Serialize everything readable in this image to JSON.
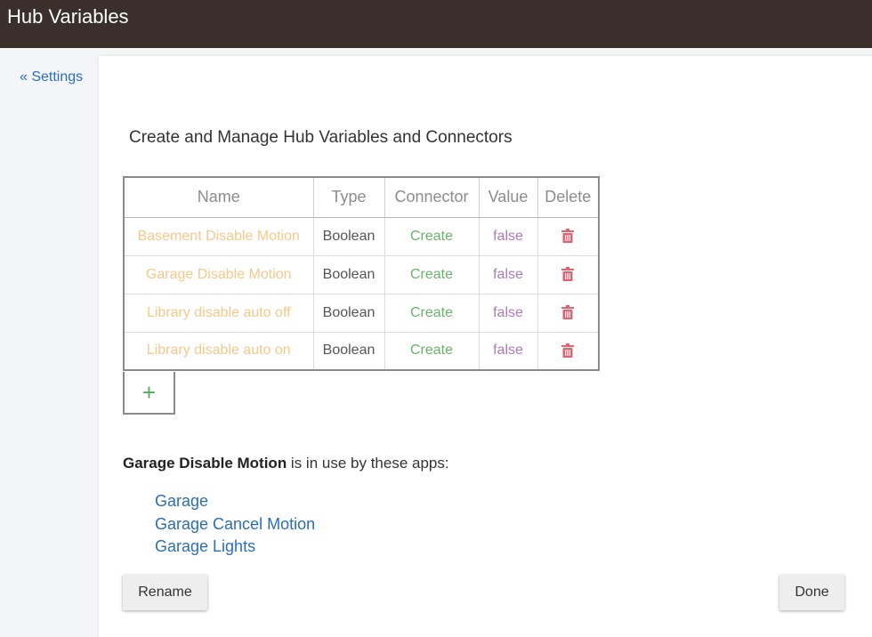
{
  "header": {
    "title": "Hub Variables"
  },
  "nav": {
    "back_label": "« Settings"
  },
  "main": {
    "title": "Create and Manage Hub Variables and Connectors",
    "table": {
      "columns": [
        "Name",
        "Type",
        "Connector",
        "Value",
        "Delete"
      ],
      "rows": [
        {
          "name": "Basement Disable Motion",
          "type": "Boolean",
          "connector": "Create",
          "value": "false"
        },
        {
          "name": "Garage Disable Motion",
          "type": "Boolean",
          "connector": "Create",
          "value": "false"
        },
        {
          "name": "Library disable auto off",
          "type": "Boolean",
          "connector": "Create",
          "value": "false"
        },
        {
          "name": "Library disable auto on",
          "type": "Boolean",
          "connector": "Create",
          "value": "false"
        }
      ],
      "add_label": "+",
      "delete_icon": "trash-icon"
    },
    "usage": {
      "variable": "Garage Disable Motion",
      "suffix": " is in use by these apps:",
      "apps": [
        "Garage",
        "Garage Cancel Motion",
        "Garage Lights"
      ]
    },
    "buttons": {
      "rename_label": "Rename",
      "done_label": "Done"
    }
  },
  "colors": {
    "topbar": "#3a2f2b",
    "link": "#2a6ebb",
    "name": "#f6c88a",
    "connector": "#6bb36b",
    "value": "#b07ab8",
    "delete": "#e2636f",
    "add": "#5aab62"
  }
}
